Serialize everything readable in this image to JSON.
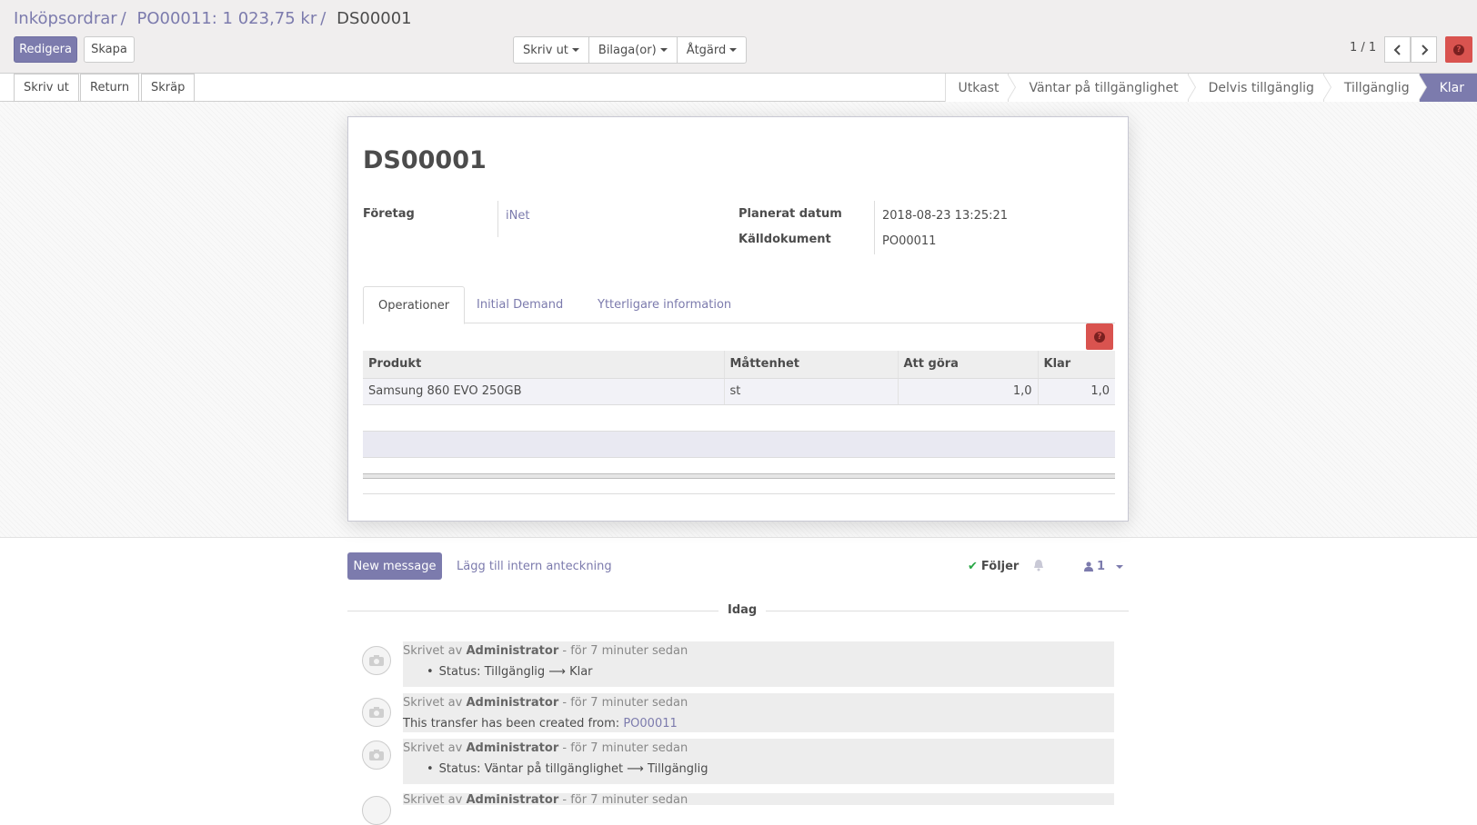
{
  "breadcrumb": {
    "items": [
      "Inköpsordrar",
      "PO00011: 1 023,75 kr"
    ],
    "current": "DS00001"
  },
  "toolbar": {
    "edit_label": "Redigera",
    "create_label": "Skapa",
    "print_label": "Skriv ut",
    "attachments_label": "Bilaga(or)",
    "action_label": "Åtgärd",
    "pager_value": "1 / 1"
  },
  "statusbar": {
    "buttons": [
      "Skriv ut",
      "Return",
      "Skräp"
    ],
    "stages": [
      "Utkast",
      "Väntar på tillgänglighet",
      "Delvis tillgänglig",
      "Tillgänglig",
      "Klar"
    ],
    "active_stage": "Klar"
  },
  "form": {
    "title": "DS00001",
    "partner_label": "Företag",
    "partner_value": "iNet",
    "scheduled_label": "Planerat datum",
    "scheduled_value": "2018-08-23 13:25:21",
    "source_label": "Källdokument",
    "source_value": "PO00011"
  },
  "tabs": [
    "Operationer",
    "Initial Demand",
    "Ytterligare information"
  ],
  "table": {
    "columns": [
      "Produkt",
      "Måttenhet",
      "Att göra",
      "Klar"
    ],
    "rows": [
      {
        "product": "Samsung 860 EVO 250GB",
        "uom": "st",
        "todo": "1,0",
        "done": "1,0"
      }
    ]
  },
  "chatter": {
    "new_message_label": "New message",
    "log_note_label": "Lägg till intern anteckning",
    "following_label": "Följer",
    "followers_count": "1",
    "date_label": "Idag",
    "messages": [
      {
        "prefix": "Skrivet av",
        "author": "Administrator",
        "time": "- för 7 minuter sedan",
        "body": "Status: Tillgänglig ⟶ Klar"
      },
      {
        "prefix": "Skrivet av",
        "author": "Administrator",
        "time": "- för 7 minuter sedan",
        "body": "This transfer has been created from:",
        "link": "PO00011"
      },
      {
        "prefix": "Skrivet av",
        "author": "Administrator",
        "time": "- för 7 minuter sedan",
        "body": "Status: Väntar på tillgänglighet ⟶ Tillgänglig"
      },
      {
        "prefix": "Skrivet av",
        "author": "Administrator",
        "time": "- för 7 minuter sedan"
      }
    ]
  },
  "colors": {
    "brand": "#7c7bad",
    "danger": "#d9534f"
  }
}
